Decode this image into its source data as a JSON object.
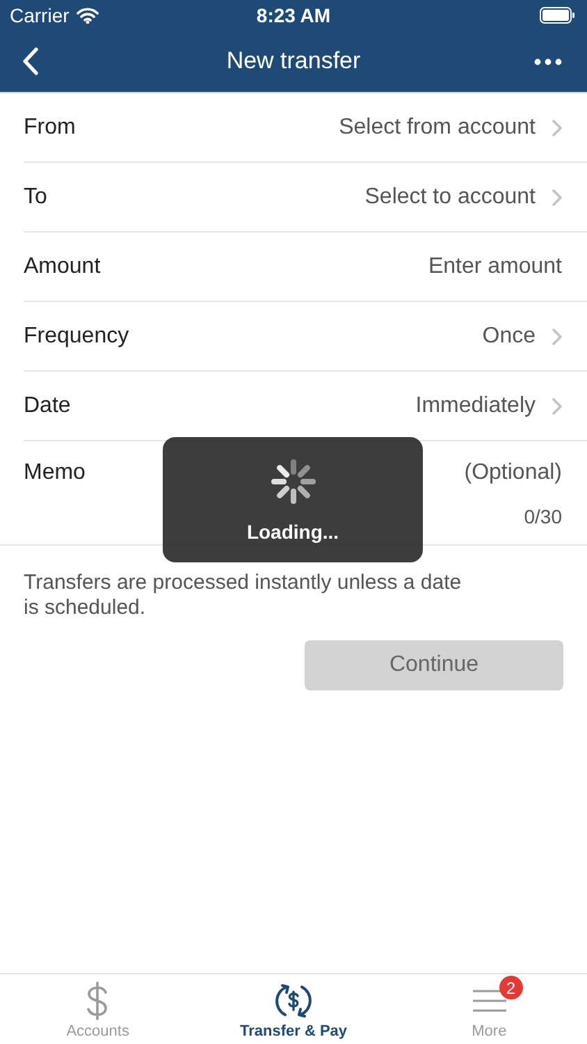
{
  "status_bar": {
    "carrier": "Carrier",
    "time": "8:23 AM"
  },
  "nav": {
    "title": "New transfer"
  },
  "form_rows": [
    {
      "label": "From",
      "value": "Select from account",
      "kind": "select"
    },
    {
      "label": "To",
      "value": "Select to account",
      "kind": "select"
    },
    {
      "label": "Amount",
      "placeholder": "Enter amount",
      "kind": "input"
    },
    {
      "label": "Frequency",
      "value": "Once",
      "kind": "select"
    },
    {
      "label": "Date",
      "value": "Immediately",
      "kind": "select"
    },
    {
      "label": "Memo",
      "placeholder": "(Optional)",
      "counter": "0/30",
      "kind": "memo"
    }
  ],
  "note": "Transfers are processed instantly unless a date is scheduled.",
  "continue_button": {
    "label": "Continue",
    "disabled": true
  },
  "loading": {
    "text": "Loading..."
  },
  "tab_bar": [
    {
      "label": "Accounts",
      "selected": false
    },
    {
      "label": "Transfer & Pay",
      "selected": true
    },
    {
      "label": "More",
      "selected": false,
      "badge": "2"
    }
  ]
}
